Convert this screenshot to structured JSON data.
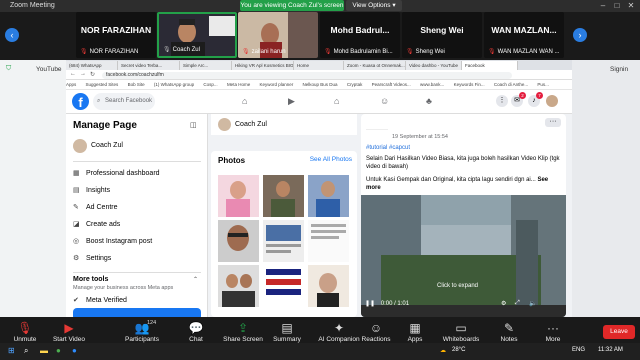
{
  "zoom": {
    "title": "Zoom Meeting",
    "share_banner": "You are viewing Coach Zul's screen",
    "view_options": "View Options"
  },
  "participants": [
    {
      "big": "NOR FARAZIHAN",
      "small": "NOR FARAZIHAN"
    },
    {
      "big": "",
      "small": "Coach Zul"
    },
    {
      "big": "",
      "small": "zailani harun"
    },
    {
      "big": "Mohd Badrul...",
      "small": "Mohd Badrulamin Bi..."
    },
    {
      "big": "Sheng Wei",
      "small": "Sheng Wei"
    },
    {
      "big": "WAN MAZLAN...",
      "small": "WAN MAZLAN WAN ..."
    }
  ],
  "side": {
    "left_label": "YouTube",
    "right_label": "Signin"
  },
  "browser": {
    "tabs": [
      "(684) WhatsApp",
      "Secret video Terba...",
      "Simple Arc...",
      "Hiking VR Apl Kosmetics BIG...",
      "Home",
      "Zoom - Kuasa ot Onnemak...",
      "Video dashbo - YouTube",
      "Facebook"
    ],
    "url": "facebook.com/coachzulfm",
    "bookmarks": [
      "Apps",
      "Suggested Sites",
      "Bob Site",
      "(1) WhatsApp group",
      "Cosp...",
      "Meta Home",
      "Keyword planner",
      "Nelkoup Bus Dua",
      "Cryptak",
      "Pearscraft Videos...",
      "www.bank...",
      "Keywords Fin...",
      "Coach di Anthe...",
      "Pus..."
    ]
  },
  "fb": {
    "search_placeholder": "Search Facebook",
    "notifications_badge": "7",
    "messages_badge": "2",
    "manage_title": "Manage Page",
    "page_name": "Coach Zul",
    "menu": [
      {
        "icon": "professional-dashboard-icon",
        "label": "Professional dashboard"
      },
      {
        "icon": "insights-icon",
        "label": "Insights"
      },
      {
        "icon": "ad-centre-icon",
        "label": "Ad Centre"
      },
      {
        "icon": "create-ads-icon",
        "label": "Create ads"
      },
      {
        "icon": "instagram-icon",
        "label": "Boost Instagram post"
      },
      {
        "icon": "settings-icon",
        "label": "Settings"
      }
    ],
    "more_tools": "More tools",
    "more_tools_sub": "Manage your business across Meta apps",
    "meta_verified": "Meta Verified",
    "photos_title": "Photos",
    "see_all_photos": "See All Photos",
    "post_date": "19 September at 15:54",
    "post_tag": "#tutorial #capcut",
    "post_text_1": "Selain Dari Hasilkan Video Biasa, kita juga boleh hasilkan Video Klip (tgk video di bawah)",
    "post_text_2": "Untuk Kasi Gempak dan Original, kita cipta lagu sendiri dgn ai...",
    "see_more": "See more",
    "click_to_expand": "Click to expand",
    "video_time": "0:00 / 1:01"
  },
  "toolbar": {
    "unmute": "Unmute",
    "start_video": "Start Video",
    "participants": "Participants",
    "participants_count": "124",
    "chat": "Chat",
    "share_screen": "Share Screen",
    "summary": "Summary",
    "ai_companion": "AI Companion",
    "reactions": "Reactions",
    "apps": "Apps",
    "whiteboards": "Whiteboards",
    "notes": "Notes",
    "more": "More",
    "leave": "Leave"
  },
  "taskbar": {
    "temp": "28°C",
    "lang": "ENG",
    "time": "11:32 AM"
  },
  "colors": {
    "fb_blue": "#1877f2",
    "zoom_green": "#23a049",
    "leave_red": "#e02828"
  }
}
